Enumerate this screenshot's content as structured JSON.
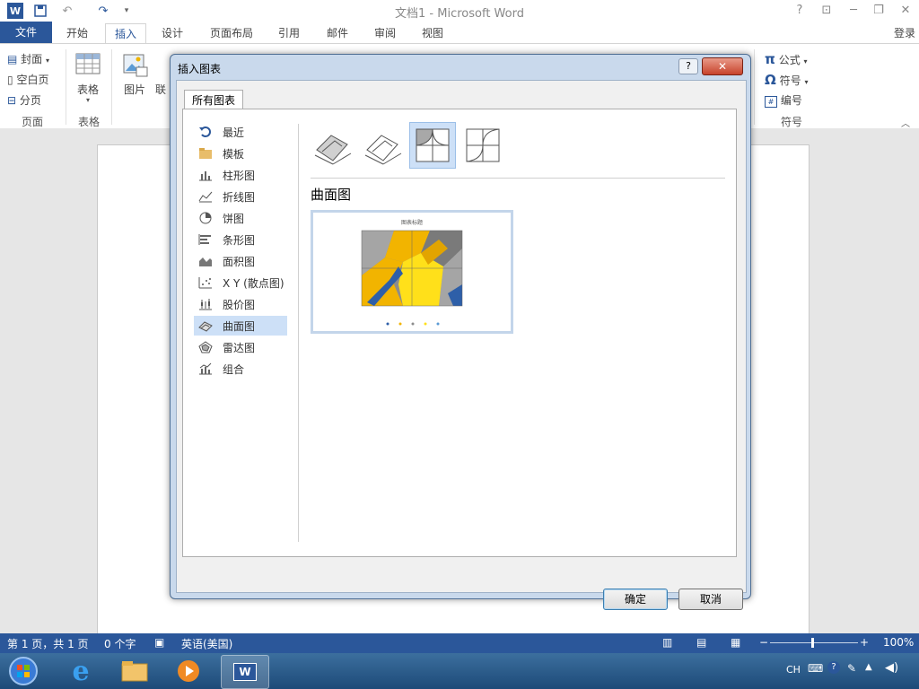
{
  "window": {
    "title": "文档1 - Microsoft Word"
  },
  "titlebar": {
    "help": "?",
    "ribbon_display": "⊡",
    "minimize": "─",
    "restore": "❐",
    "close": "✕"
  },
  "tabs": {
    "file": "文件",
    "home": "开始",
    "insert": "插入",
    "design": "设计",
    "layout": "页面布局",
    "references": "引用",
    "mailings": "邮件",
    "review": "审阅",
    "view": "视图"
  },
  "login": "登录",
  "ribbon": {
    "pages_group": {
      "cover": "封面",
      "blank": "空白页",
      "break": "分页",
      "name": "页面"
    },
    "table_group": {
      "table": "表格",
      "name": "表格"
    },
    "illus_group": {
      "picture": "图片",
      "online": "联"
    },
    "symbols_group": {
      "equation": "公式",
      "symbol": "符号",
      "number": "编号",
      "name": "符号"
    }
  },
  "dialog": {
    "title": "插入图表",
    "help": "?",
    "close": "✕",
    "tab_all": "所有图表",
    "categories": [
      {
        "label": "最近",
        "icon": "recent-icon"
      },
      {
        "label": "模板",
        "icon": "folder-icon"
      },
      {
        "label": "柱形图",
        "icon": "column-chart-icon"
      },
      {
        "label": "折线图",
        "icon": "line-chart-icon"
      },
      {
        "label": "饼图",
        "icon": "pie-chart-icon"
      },
      {
        "label": "条形图",
        "icon": "bar-chart-icon"
      },
      {
        "label": "面积图",
        "icon": "area-chart-icon"
      },
      {
        "label": "X Y (散点图)",
        "icon": "scatter-chart-icon"
      },
      {
        "label": "股价图",
        "icon": "stock-chart-icon"
      },
      {
        "label": "曲面图",
        "icon": "surface-chart-icon",
        "selected": true
      },
      {
        "label": "雷达图",
        "icon": "radar-chart-icon"
      },
      {
        "label": "组合",
        "icon": "combo-chart-icon"
      }
    ],
    "chart_heading": "曲面图",
    "preview": {
      "title": "图表标题"
    },
    "ok": "确定",
    "cancel": "取消"
  },
  "statusbar": {
    "page": "第 1 页，共 1 页",
    "words": "0 个字",
    "language": "英语(美国)",
    "zoom": "100%"
  },
  "taskbar": {
    "lang": "CH"
  },
  "colors": {
    "accent": "#2b579a",
    "selection": "#cde0f7"
  }
}
